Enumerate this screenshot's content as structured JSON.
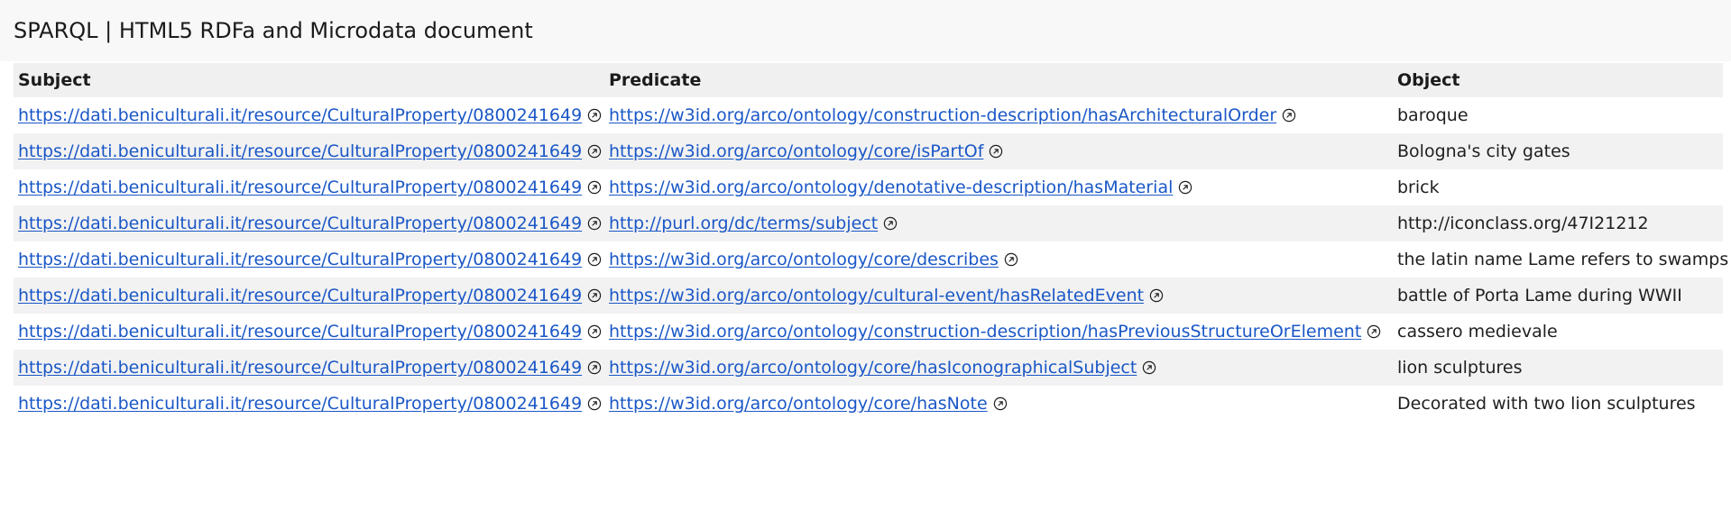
{
  "page": {
    "title": "SPARQL | HTML5 RDFa and Microdata document"
  },
  "table": {
    "headers": [
      "Subject",
      "Predicate",
      "Object"
    ],
    "rows": [
      {
        "subject": "https://dati.beniculturali.it/resource/CulturalProperty/0800241649",
        "predicate": "https://w3id.org/arco/ontology/construction-description/hasArchitecturalOrder",
        "object": "baroque"
      },
      {
        "subject": "https://dati.beniculturali.it/resource/CulturalProperty/0800241649",
        "predicate": "https://w3id.org/arco/ontology/core/isPartOf",
        "object": "Bologna's city gates"
      },
      {
        "subject": "https://dati.beniculturali.it/resource/CulturalProperty/0800241649",
        "predicate": "https://w3id.org/arco/ontology/denotative-description/hasMaterial",
        "object": "brick"
      },
      {
        "subject": "https://dati.beniculturali.it/resource/CulturalProperty/0800241649",
        "predicate": "http://purl.org/dc/terms/subject",
        "object": "http://iconclass.org/47I21212"
      },
      {
        "subject": "https://dati.beniculturali.it/resource/CulturalProperty/0800241649",
        "predicate": "https://w3id.org/arco/ontology/core/describes",
        "object": "the latin name Lame refers to swamps"
      },
      {
        "subject": "https://dati.beniculturali.it/resource/CulturalProperty/0800241649",
        "predicate": "https://w3id.org/arco/ontology/cultural-event/hasRelatedEvent",
        "object": "battle of Porta Lame during WWII"
      },
      {
        "subject": "https://dati.beniculturali.it/resource/CulturalProperty/0800241649",
        "predicate": "https://w3id.org/arco/ontology/construction-description/hasPreviousStructureOrElement",
        "object": "cassero medievale"
      },
      {
        "subject": "https://dati.beniculturali.it/resource/CulturalProperty/0800241649",
        "predicate": "https://w3id.org/arco/ontology/core/hasIconographicalSubject",
        "object": "lion sculptures"
      },
      {
        "subject": "https://dati.beniculturali.it/resource/CulturalProperty/0800241649",
        "predicate": "https://w3id.org/arco/ontology/core/hasNote",
        "object": "Decorated with two lion sculptures"
      }
    ]
  },
  "icons": {
    "external_link": "external-link-icon"
  },
  "colors": {
    "link": "#1a57c7",
    "header_bg": "#f0f0f0",
    "stripe_bg": "#f2f2f2",
    "topbar_bg": "#f8f8f9"
  }
}
